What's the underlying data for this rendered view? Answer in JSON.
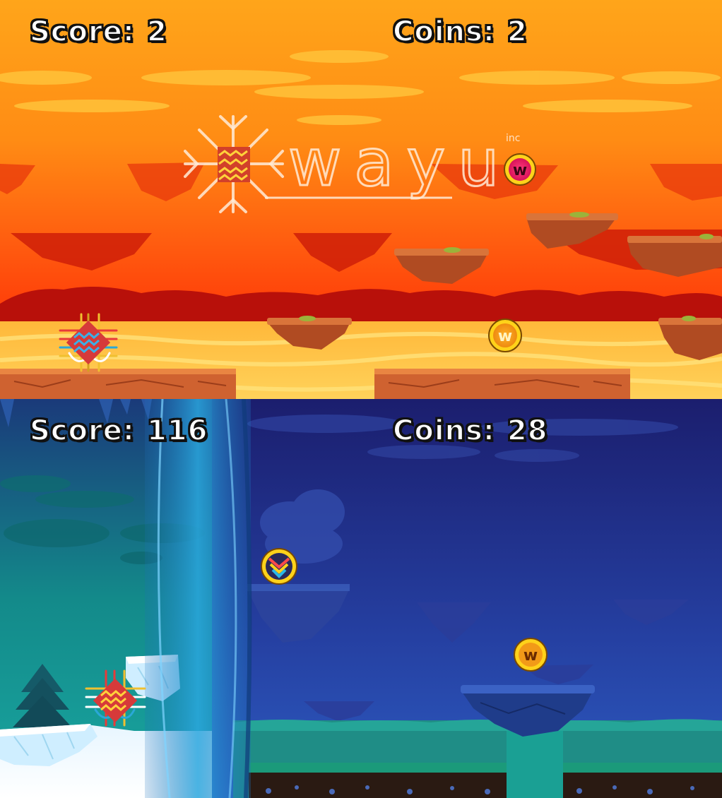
{
  "top_game": {
    "theme": "sunset-desert",
    "score_label": "Score:",
    "score_value": "2",
    "coins_label": "Coins:",
    "coins_value": "2",
    "watermark": {
      "word": "wayu",
      "suffix": "inc"
    },
    "coins": [
      {
        "icon": "coin-w-pink-icon",
        "letter": "w"
      },
      {
        "icon": "coin-w-gold-icon",
        "letter": "w"
      }
    ],
    "colors": {
      "sky_top": "#ffa21a",
      "sky_mid": "#ff5a10",
      "ground": "#ffc13a",
      "platform": "#d7692e"
    }
  },
  "bottom_game": {
    "theme": "night-ice",
    "score_label": "Score:",
    "score_value": "116",
    "coins_label": "Coins:",
    "coins_value": "28",
    "coins": [
      {
        "icon": "coin-chevron-icon",
        "letter": ""
      },
      {
        "icon": "coin-w-gold-icon",
        "letter": "w"
      }
    ],
    "colors": {
      "sky_top": "#1c1f72",
      "sky_bottom": "#2b4fb0",
      "grass": "#1e8b7b",
      "portal": "#2a9fd6"
    }
  }
}
